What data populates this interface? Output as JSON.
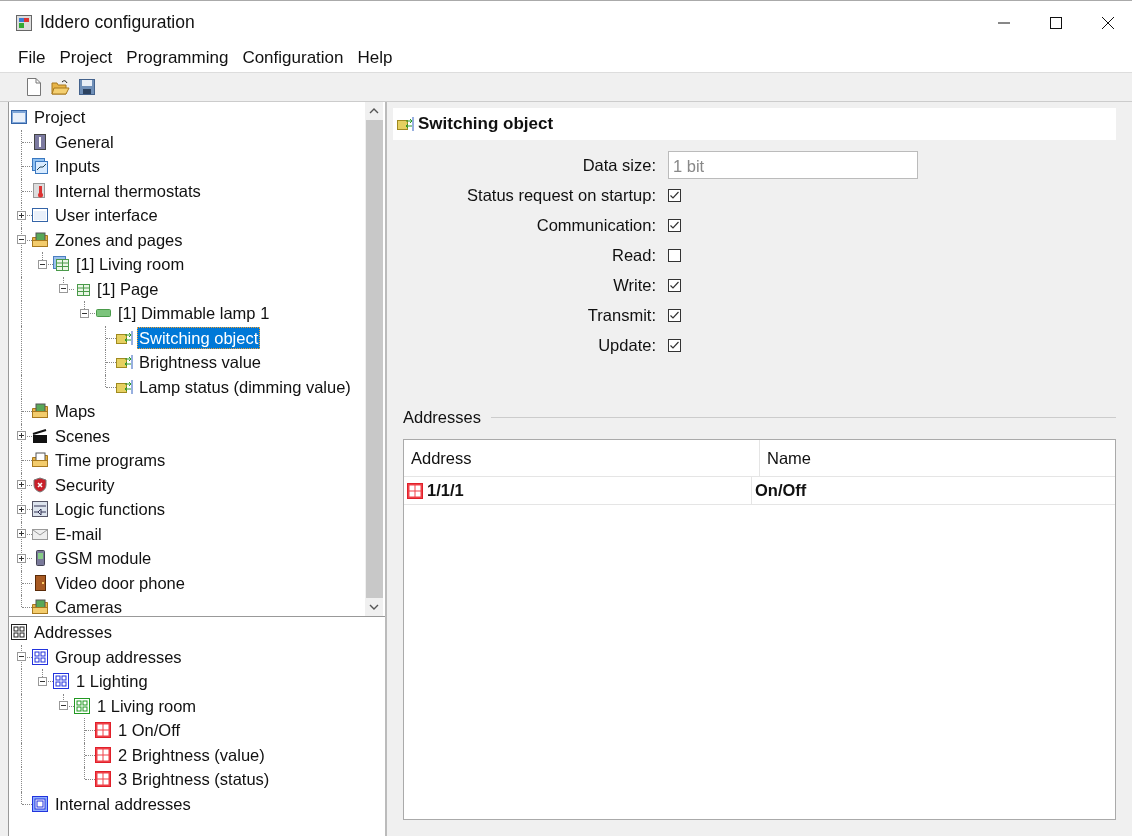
{
  "window": {
    "title": "Iddero configuration"
  },
  "menu": [
    {
      "label": "File"
    },
    {
      "label": "Project"
    },
    {
      "label": "Programming"
    },
    {
      "label": "Configuration"
    },
    {
      "label": "Help"
    }
  ],
  "project_tree": {
    "items": [
      {
        "label": "Project",
        "kind": "project",
        "selected": false,
        "children": [
          {
            "label": "General",
            "kind": "general",
            "selected": false
          },
          {
            "label": "Inputs",
            "kind": "inputs",
            "selected": false
          },
          {
            "label": "Internal thermostats",
            "kind": "thermostat",
            "selected": false
          },
          {
            "label": "User interface",
            "kind": "window",
            "selected": false,
            "expanded": false
          },
          {
            "label": "Zones and pages",
            "kind": "folder-grid",
            "selected": false,
            "expanded": true,
            "children": [
              {
                "label": "[1] Living room",
                "kind": "zone",
                "selected": false,
                "expanded": true,
                "children": [
                  {
                    "label": "[1] Page",
                    "kind": "page",
                    "selected": false,
                    "expanded": true,
                    "children": [
                      {
                        "label": "[1] Dimmable lamp 1",
                        "kind": "lamp",
                        "selected": false,
                        "expanded": true,
                        "children": [
                          {
                            "label": "Switching object",
                            "kind": "object",
                            "selected": true
                          },
                          {
                            "label": "Brightness value",
                            "kind": "object",
                            "selected": false
                          },
                          {
                            "label": "Lamp status (dimming value)",
                            "kind": "object",
                            "selected": false
                          }
                        ]
                      }
                    ]
                  }
                ]
              }
            ]
          },
          {
            "label": "Maps",
            "kind": "folder-map",
            "selected": false
          },
          {
            "label": "Scenes",
            "kind": "clapper",
            "selected": false,
            "expanded": false
          },
          {
            "label": "Time programs",
            "kind": "folder-clock",
            "selected": false
          },
          {
            "label": "Security",
            "kind": "shield",
            "selected": false,
            "expanded": false
          },
          {
            "label": "Logic functions",
            "kind": "logic",
            "selected": false,
            "expanded": false
          },
          {
            "label": "E-mail",
            "kind": "envelope",
            "selected": false,
            "expanded": false
          },
          {
            "label": "GSM module",
            "kind": "phone",
            "selected": false,
            "expanded": false
          },
          {
            "label": "Video door phone",
            "kind": "door",
            "selected": false
          },
          {
            "label": "Cameras",
            "kind": "folder-camera",
            "selected": false
          }
        ]
      }
    ]
  },
  "address_tree": {
    "items": [
      {
        "label": "Addresses",
        "kind": "addr-root",
        "selected": false,
        "children": [
          {
            "label": "Group addresses",
            "kind": "addr-blue",
            "selected": false,
            "expanded": true,
            "children": [
              {
                "label": "1 Lighting",
                "kind": "addr-blue",
                "selected": false,
                "expanded": true,
                "children": [
                  {
                    "label": "1 Living room",
                    "kind": "addr-green",
                    "selected": false,
                    "expanded": true,
                    "children": [
                      {
                        "label": "1 On/Off",
                        "kind": "addr-red",
                        "selected": false
                      },
                      {
                        "label": "2 Brightness (value)",
                        "kind": "addr-red",
                        "selected": false
                      },
                      {
                        "label": "3 Brightness (status)",
                        "kind": "addr-red",
                        "selected": false
                      }
                    ]
                  }
                ]
              }
            ]
          },
          {
            "label": "Internal addresses",
            "kind": "addr-internal",
            "selected": false
          }
        ]
      }
    ]
  },
  "detail": {
    "title": "Switching object",
    "fields": [
      {
        "kind": "text",
        "label": "Data size:",
        "value": "1 bit",
        "disabled": true
      },
      {
        "kind": "checkbox",
        "label": "Status request on startup:",
        "checked": true
      },
      {
        "kind": "checkbox",
        "label": "Communication:",
        "checked": true
      },
      {
        "kind": "checkbox",
        "label": "Read:",
        "checked": false
      },
      {
        "kind": "checkbox",
        "label": "Write:",
        "checked": true
      },
      {
        "kind": "checkbox",
        "label": "Transmit:",
        "checked": true
      },
      {
        "kind": "checkbox",
        "label": "Update:",
        "checked": true
      }
    ],
    "addresses": {
      "title": "Addresses",
      "columns": [
        "Address",
        "Name"
      ],
      "rows": [
        {
          "cells": [
            "1/1/1",
            "On/Off"
          ]
        }
      ]
    }
  }
}
